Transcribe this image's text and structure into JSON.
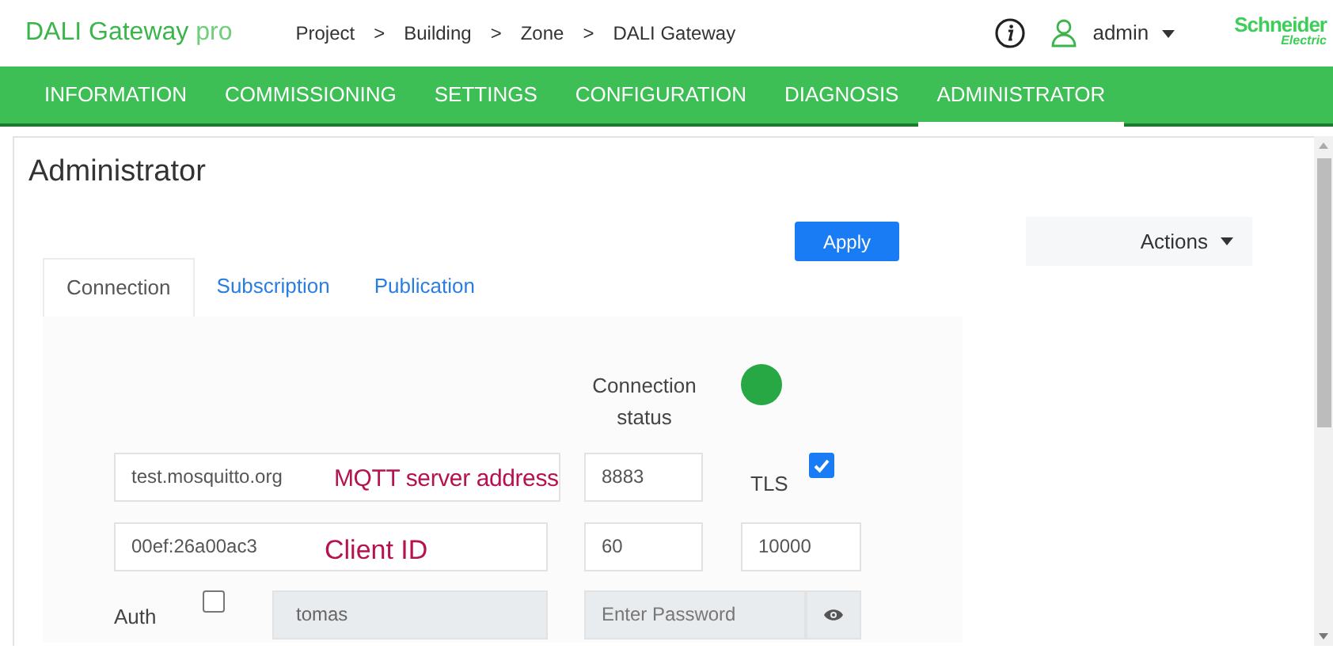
{
  "header": {
    "app_name": "DALI Gateway",
    "app_suffix": "pro",
    "breadcrumb": [
      "Project",
      "Building",
      "Zone",
      "DALI Gateway"
    ],
    "separators": [
      ">",
      ">",
      ">"
    ],
    "user": "admin",
    "brand": "Schneider",
    "brand_sub": "Electric"
  },
  "nav": [
    {
      "label": "INFORMATION",
      "selected": false
    },
    {
      "label": "COMMISSIONING",
      "selected": false
    },
    {
      "label": "SETTINGS",
      "selected": false
    },
    {
      "label": "CONFIGURATION",
      "selected": false
    },
    {
      "label": "DIAGNOSIS",
      "selected": false
    },
    {
      "label": "ADMINISTRATOR",
      "selected": true
    }
  ],
  "page_title": "Administrator",
  "apply_button": "Apply",
  "actions_button": "Actions",
  "tabs": [
    {
      "label": "Connection",
      "selected": true
    },
    {
      "label": "Subscription",
      "selected": false
    },
    {
      "label": "Publication",
      "selected": false
    }
  ],
  "connection_status": {
    "label": "Connection status",
    "connected": true
  },
  "server": {
    "address": "test.mosquitto.org",
    "port": "8883",
    "tls_label": "TLS",
    "tls": true
  },
  "client": {
    "id": "00ef:26a00ac3",
    "keepalive": "60",
    "timeout": "10000"
  },
  "auth": {
    "label": "Auth",
    "enabled": false,
    "username": "tomas",
    "password_placeholder": "Enter Password"
  },
  "annotations": [
    "MQTT server address",
    "Client ID"
  ]
}
